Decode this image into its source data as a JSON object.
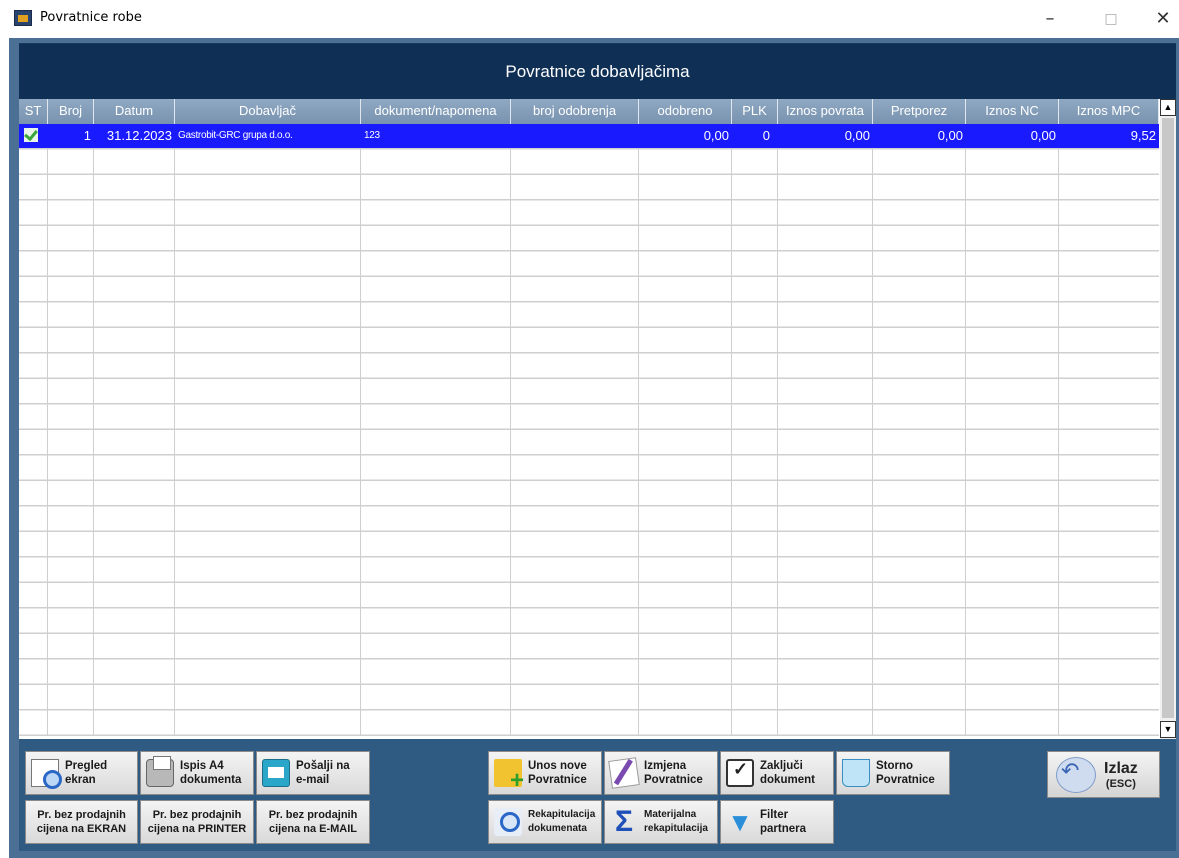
{
  "window": {
    "title": "Povratnice robe",
    "minimize": "–",
    "maximize": "□",
    "close": "✕"
  },
  "header": {
    "title": "Povratnice dobavljačima"
  },
  "grid": {
    "columns": [
      "ST",
      "Broj",
      "Datum",
      "Dobavljač",
      "dokument/napomena",
      "broj odobrenja",
      "odobreno",
      "PLK",
      "Iznos povrata",
      "Pretporez",
      "Iznos NC",
      "Iznos MPC"
    ],
    "rows": [
      {
        "status_icon": "check-icon",
        "broj": "1",
        "datum": "31.12.2023",
        "dobavljac": "Gastrobit-GRC grupa d.o.o.",
        "dokument": "123",
        "broj_odobrenja": "",
        "odobreno": "0,00",
        "plk": "0",
        "iznos_povrata": "0,00",
        "pretporez": "0,00",
        "iznos_nc": "0,00",
        "iznos_mpc": "9,52"
      }
    ],
    "selected_row_color": "#1a1aff",
    "scroll_up": "▲",
    "scroll_down": "▼"
  },
  "buttons": {
    "pregled_ekran": "Pregled\nekran",
    "ispis_a4": "Ispis A4\ndokumenta",
    "posalji_email": "Pošalji na\ne-mail",
    "unos_nove": "Unos nove\nPovratnice",
    "izmjena": "Izmjena\nPovratnice",
    "zakljuci": "Zaključi\ndokument",
    "storno": "Storno\nPovratnice",
    "izlaz": "Izlaz",
    "izlaz_sub": "(ESC)",
    "pr_ekran": "Pr. bez prodajnih\ncijena na EKRAN",
    "pr_printer": "Pr. bez prodajnih\ncijena na PRINTER",
    "pr_email": "Pr. bez prodajnih\ncijena na E-MAIL",
    "rekapitulacija": "Rekapitulacija\ndokumenata",
    "materijalna": "Materijalna\nrekapitulacija",
    "filter": "Filter\npartnera"
  },
  "colors": {
    "header_bg": "#0f2f55",
    "panel_bg": "#2f5a82",
    "column_header_bg": "#7f99b6"
  }
}
